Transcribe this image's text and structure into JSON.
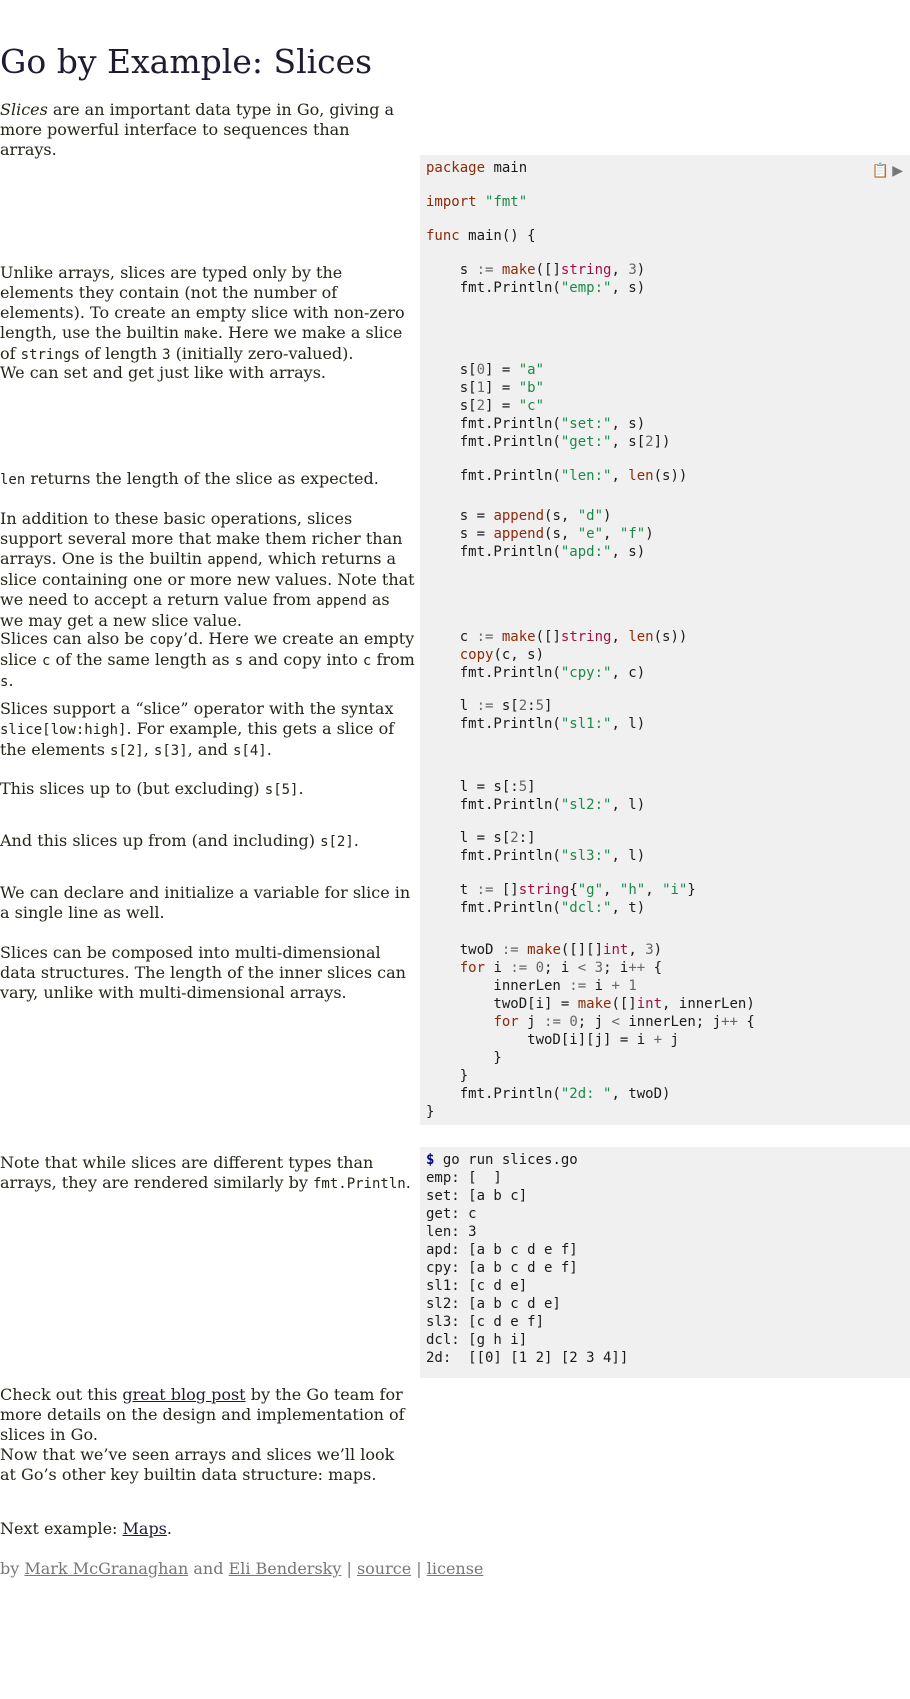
{
  "page": {
    "title": "Go by Example: Slices",
    "intro_em": "Slices",
    "intro_rest": " are an important data type in Go, giving a more powerful interface to sequences than arrays."
  },
  "sections": {
    "s1": {
      "p1": "Unlike arrays, slices are typed only by the elements they contain (not the number of elements). To create an empty slice with non-zero length, use the builtin ",
      "c1": "make",
      "p2": ". Here we make a slice of ",
      "c2": "string",
      "p3": "s of length ",
      "c3": "3",
      "p4": " (initially zero-valued)."
    },
    "s2": {
      "p1": "We can set and get just like with arrays."
    },
    "s3": {
      "c1": "len",
      "p1": " returns the length of the slice as expected."
    },
    "s4": {
      "p1": "In addition to these basic operations, slices support several more that make them richer than arrays. One is the builtin ",
      "c1": "append",
      "p2": ", which returns a slice containing one or more new values. Note that we need to accept a return value from ",
      "c2": "append",
      "p3": " as we may get a new slice value."
    },
    "s5": {
      "p1": "Slices can also be ",
      "c1": "copy",
      "p2": "’d. Here we create an empty slice ",
      "c2": "c",
      "p3": " of the same length as ",
      "c3": "s",
      "p4": " and copy into ",
      "c4": "c",
      "p5": " from ",
      "c5": "s",
      "p6": "."
    },
    "s6": {
      "p1": "Slices support a “slice” operator with the syntax ",
      "c1": "slice[low:high]",
      "p2": ". For example, this gets a slice of the elements ",
      "c2": "s[2]",
      "p3": ", ",
      "c3": "s[3]",
      "p4": ", and ",
      "c4": "s[4]",
      "p5": "."
    },
    "s7": {
      "p1": "This slices up to (but excluding) ",
      "c1": "s[5]",
      "p2": "."
    },
    "s8": {
      "p1": "And this slices up from (and including) ",
      "c1": "s[2]",
      "p2": "."
    },
    "s9": {
      "p1": "We can declare and initialize a variable for slice in a single line as well."
    },
    "s10": {
      "p1": "Slices can be composed into multi-dimensional data structures. The length of the inner slices can vary, unlike with multi-dimensional arrays."
    },
    "s11": {
      "p1": "Note that while slices are different types than arrays, they are rendered similarly by ",
      "c1": "fmt.Println",
      "p2": "."
    },
    "s12": {
      "p1": "Check out this ",
      "link": "great blog post",
      "p2": " by the Go team for more details on the design and implementation of slices in Go."
    },
    "s13": {
      "p1": "Now that we’ve seen arrays and slices we’ll look at Go’s other key builtin data structure: maps."
    }
  },
  "output": {
    "command": " go run slices.go",
    "prompt": "$",
    "lines": [
      "emp: [  ]",
      "set: [a b c]",
      "get: c",
      "len: 3",
      "apd: [a b c d e f]",
      "cpy: [a b c d e f]",
      "sl1: [c d e]",
      "sl2: [a b c d e]",
      "sl3: [c d e f]",
      "dcl: [g h i]",
      "2d:  [[0] [1 2] [2 3 4]]"
    ]
  },
  "next": {
    "label": "Next example: ",
    "link": "Maps",
    "suffix": "."
  },
  "footer": {
    "by": "by ",
    "author1": "Mark McGranaghan",
    "and": " and ",
    "author2": "Eli Bendersky",
    "sep1": " | ",
    "source": "source",
    "sep2": " | ",
    "license": "license"
  },
  "icons": {
    "copy": "clipboard-icon",
    "run": "run-icon"
  }
}
